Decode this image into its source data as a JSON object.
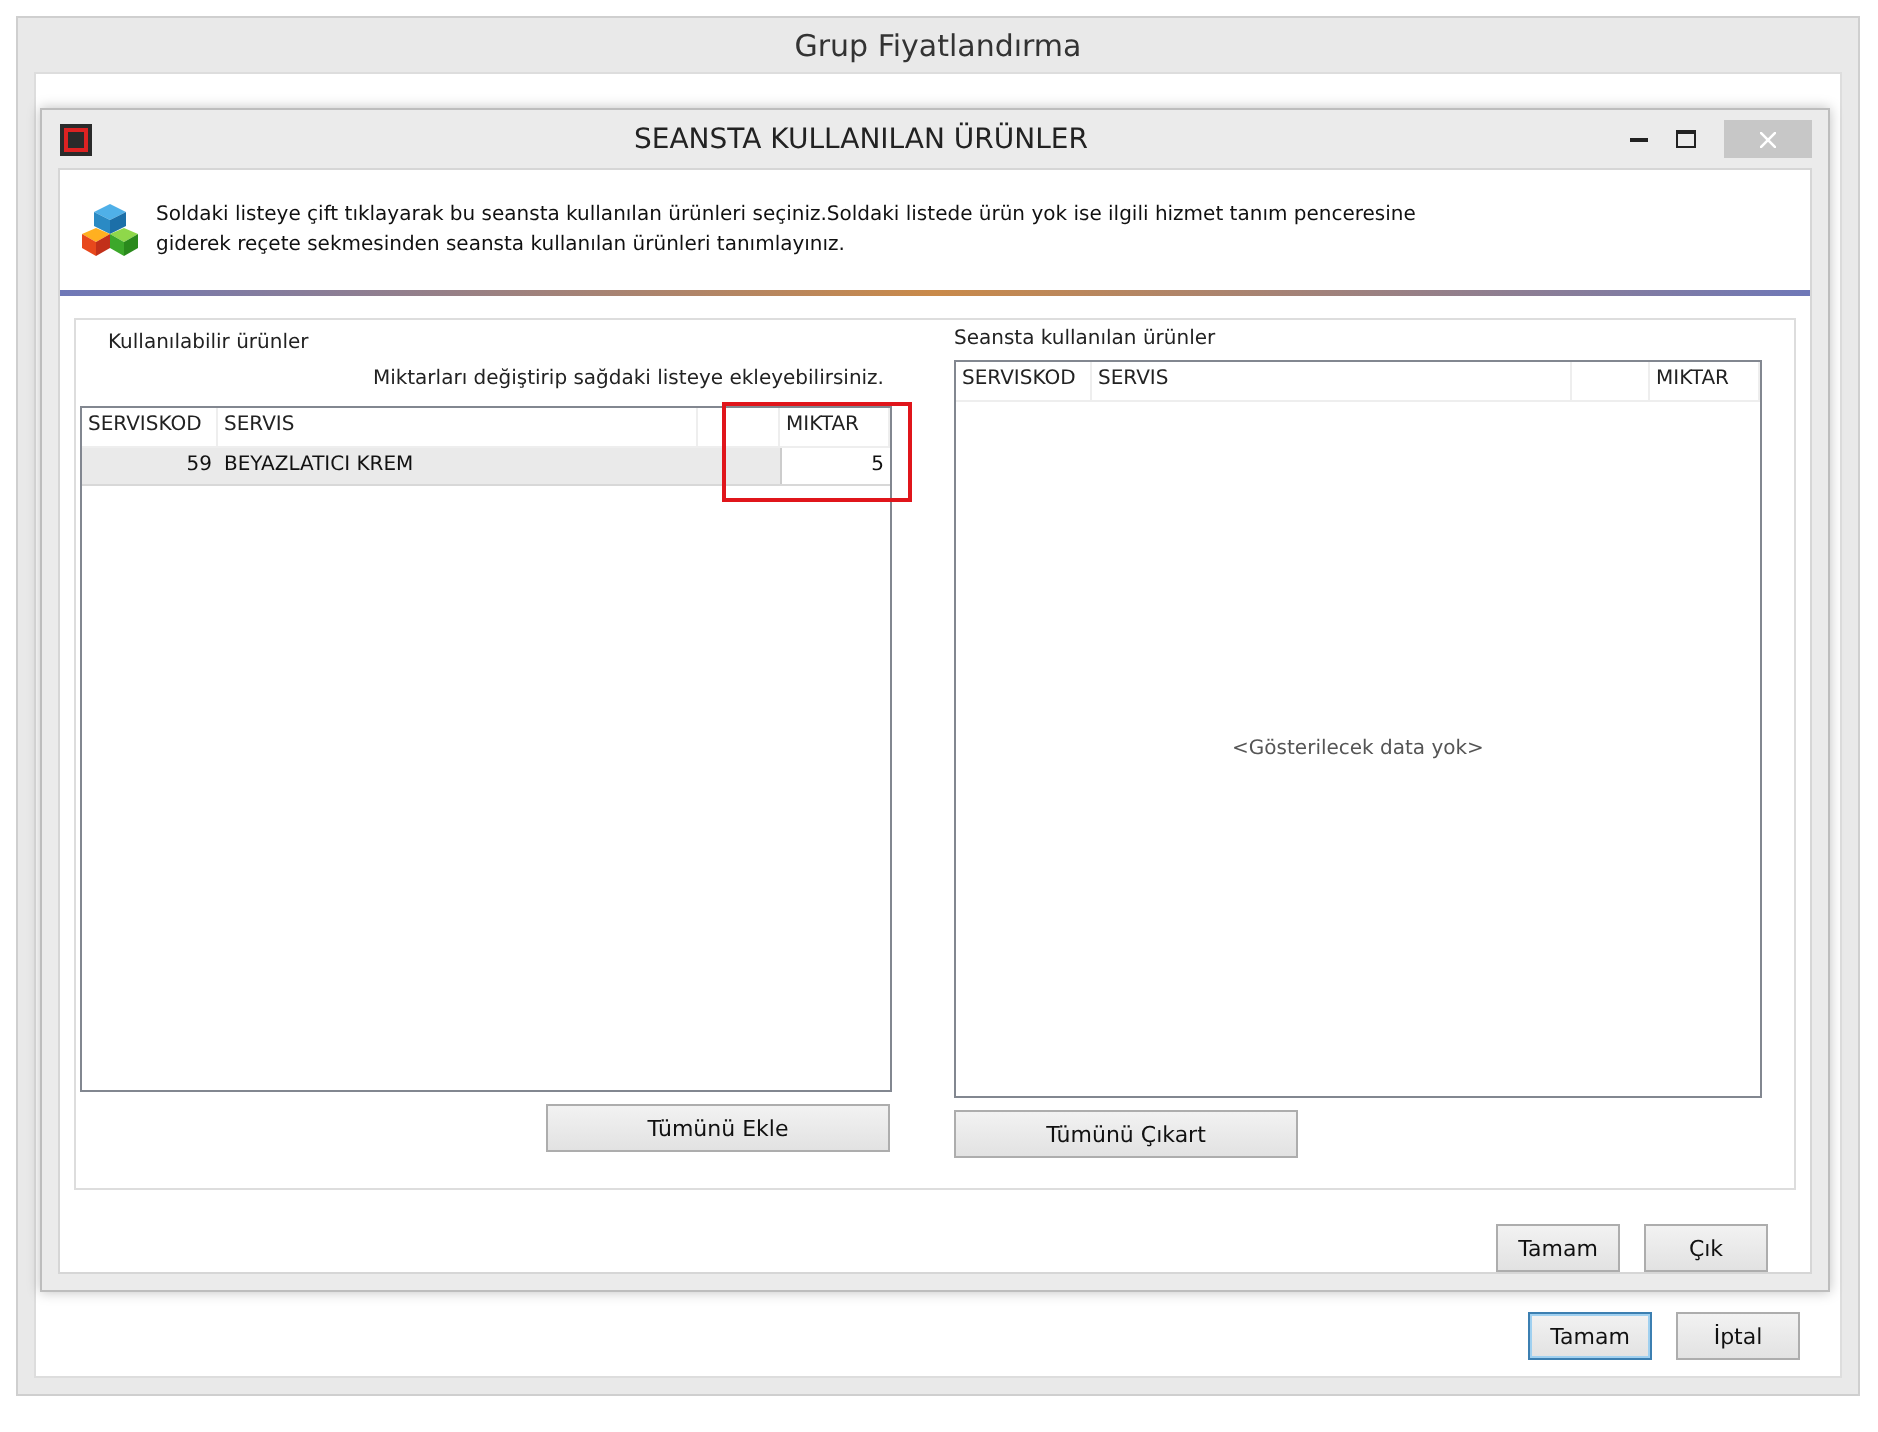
{
  "outer_window": {
    "title": "Grup Fiyatlandırma",
    "buttons": [
      {
        "label": "Tamam",
        "default": true
      },
      {
        "label": "İptal",
        "default": false
      }
    ]
  },
  "dialog": {
    "title": "SEANSTA KULLANILAN ÜRÜNLER",
    "info_lines": [
      "Soldaki listeye çift tıklayarak bu seansta kullanılan ürünleri seçiniz.Soldaki listede ürün yok ise ilgili hizmet tanım penceresine",
      "giderek reçete sekmesinden seansta kullanılan ürünleri tanımlayınız."
    ],
    "left": {
      "title": "Kullanılabilir ürünler",
      "hint": "Miktarları değiştirip sağdaki listeye ekleyebilirsiniz.",
      "columns": [
        "SERVISKOD",
        "SERVIS",
        "MIKTAR"
      ],
      "rows": [
        {
          "cells": [
            "59",
            "BEYAZLATICI KREM",
            "5"
          ],
          "selected": true
        }
      ],
      "button": "Tümünü Ekle",
      "highlight_quantity": true
    },
    "right": {
      "title": "Seansta kullanılan ürünler",
      "columns": [
        "SERVISKOD",
        "SERVIS",
        "MIKTAR"
      ],
      "empty_text": "<Gösterilecek data yok>",
      "button": "Tümünü Çıkart"
    },
    "buttons": [
      "Tamam",
      "Çık"
    ]
  }
}
